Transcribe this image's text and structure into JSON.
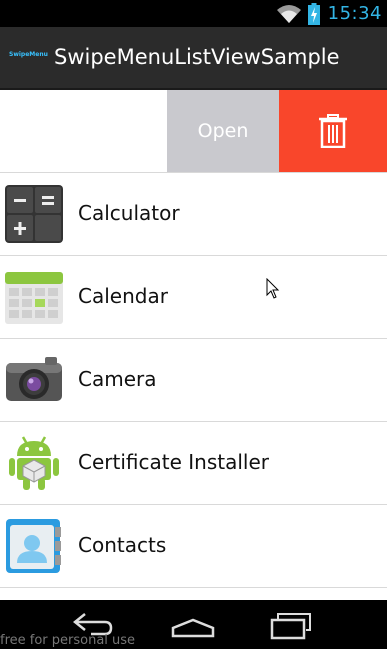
{
  "status_bar": {
    "time": "15:34",
    "icons": [
      "wifi-icon",
      "battery-charging-icon"
    ],
    "accent": "#33b5e5"
  },
  "action_bar": {
    "logo_text": "SwipeMenu",
    "title": "SwipeMenuListViewSample"
  },
  "swipe_menu": {
    "open_label": "Open",
    "delete_icon": "trash-icon",
    "open_color": "#c9c9ce",
    "delete_color": "#f9462b"
  },
  "list": {
    "items": [
      {
        "label": "Calculator",
        "icon": "calculator-icon"
      },
      {
        "label": "Calendar",
        "icon": "calendar-icon"
      },
      {
        "label": "Camera",
        "icon": "camera-icon"
      },
      {
        "label": "Certificate Installer",
        "icon": "certificate-installer-icon"
      },
      {
        "label": "Contacts",
        "icon": "contacts-icon"
      }
    ]
  },
  "nav_bar": {
    "buttons": [
      "back-icon",
      "home-icon",
      "recents-icon"
    ]
  },
  "watermark": "free for personal use"
}
